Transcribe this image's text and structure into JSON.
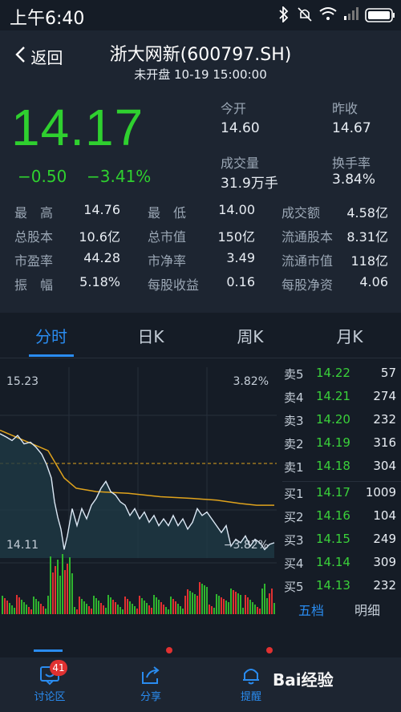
{
  "status_bar": {
    "time": "上午6:40"
  },
  "header": {
    "back_label": "返回",
    "title": "浙大网新(600797.SH)",
    "subtitle": "未开盘 10-19 15:00:00"
  },
  "quote": {
    "price": "14.17",
    "change": "−0.50",
    "change_pct": "−3.41%",
    "open_label": "今开",
    "open_value": "14.60",
    "prev_close_label": "昨收",
    "prev_close_value": "14.67",
    "volume_label": "成交量",
    "volume_value": "31.9万手",
    "turnover_label": "换手率",
    "turnover_value": "3.84%"
  },
  "stats": [
    [
      {
        "label": "最　高",
        "value": "14.76"
      },
      {
        "label": "最　低",
        "value": "14.00"
      },
      {
        "label": "成交额",
        "value": "4.58亿"
      }
    ],
    [
      {
        "label": "总股本",
        "value": "10.6亿"
      },
      {
        "label": "总市值",
        "value": "150亿"
      },
      {
        "label": "流通股本",
        "value": "8.31亿"
      }
    ],
    [
      {
        "label": "市盈率",
        "value": "44.28"
      },
      {
        "label": "市净率",
        "value": "3.49"
      },
      {
        "label": "流通市值",
        "value": "118亿"
      }
    ],
    [
      {
        "label": "振　幅",
        "value": "5.18%"
      },
      {
        "label": "每股收益",
        "value": "0.16"
      },
      {
        "label": "每股净资",
        "value": "4.06"
      }
    ]
  ],
  "tabs": [
    "分时",
    "日K",
    "周K",
    "月K"
  ],
  "chart": {
    "top_price": "15.23",
    "top_pct": "3.82%",
    "bottom_price": "14.11",
    "bottom_pct": "−3.82%",
    "colors": {
      "price_line": "#dce8f5",
      "avg_line": "#e0a31c",
      "up": "#e03131",
      "down": "#2fb52f",
      "prev_close": "#e0a31c"
    }
  },
  "order_book": {
    "sell": [
      {
        "label": "卖5",
        "price": "14.22",
        "volume": "57"
      },
      {
        "label": "卖4",
        "price": "14.21",
        "volume": "274"
      },
      {
        "label": "卖3",
        "price": "14.20",
        "volume": "232"
      },
      {
        "label": "卖2",
        "price": "14.19",
        "volume": "316"
      },
      {
        "label": "卖1",
        "price": "14.18",
        "volume": "304"
      }
    ],
    "buy": [
      {
        "label": "买1",
        "price": "14.17",
        "volume": "1009"
      },
      {
        "label": "买2",
        "price": "14.16",
        "volume": "104"
      },
      {
        "label": "买3",
        "price": "14.15",
        "volume": "249"
      },
      {
        "label": "买4",
        "price": "14.14",
        "volume": "309"
      },
      {
        "label": "买5",
        "price": "14.13",
        "volume": "232"
      }
    ],
    "tab_five": "五档",
    "tab_detail": "明细"
  },
  "bottom_nav": {
    "badge": "41",
    "items": [
      {
        "label": "讨论区",
        "icon": "message-icon"
      },
      {
        "label": "分享",
        "icon": "share-icon"
      },
      {
        "label": "提醒",
        "icon": "bell-icon"
      }
    ]
  },
  "watermark": "Bai经验"
}
